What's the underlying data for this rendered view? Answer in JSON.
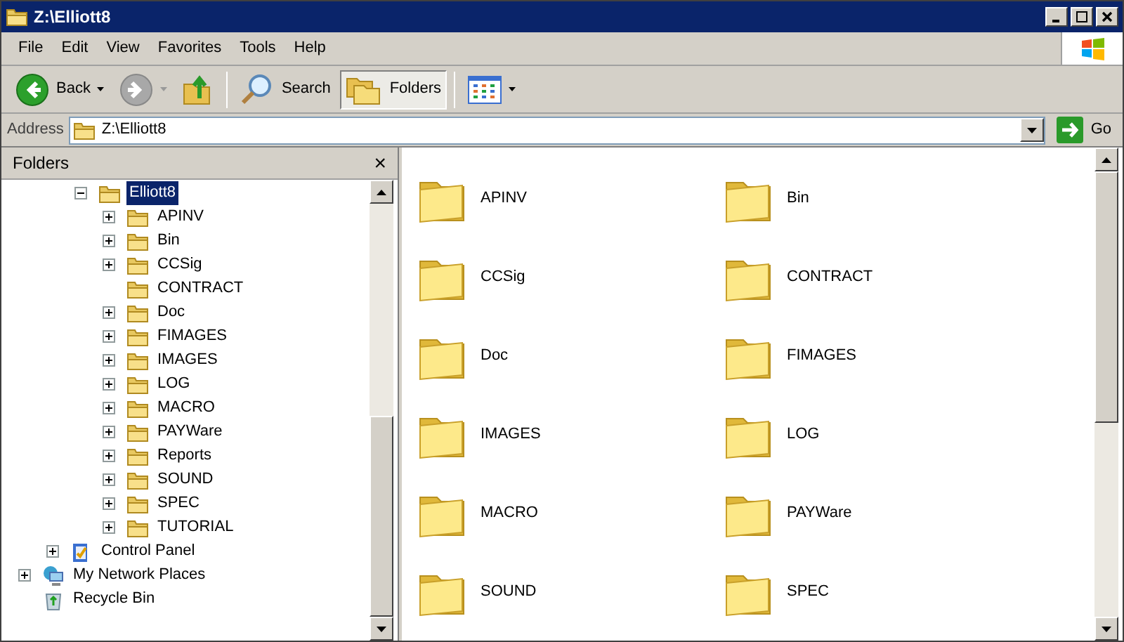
{
  "window": {
    "title": "Z:\\Elliott8"
  },
  "menu": [
    "File",
    "Edit",
    "View",
    "Favorites",
    "Tools",
    "Help"
  ],
  "toolbar": [
    {
      "kind": "back",
      "label": "Back",
      "disabled": false,
      "selected": false
    },
    {
      "kind": "forward",
      "disabled": true,
      "selected": false
    },
    {
      "kind": "up",
      "selected": false
    },
    {
      "kind": "search",
      "label": "Search",
      "selected": false
    },
    {
      "kind": "folders",
      "label": "Folders",
      "selected": true
    },
    {
      "kind": "views",
      "selected": false
    }
  ],
  "address": {
    "label": "Address",
    "value": "Z:\\Elliott8",
    "go": "Go"
  },
  "folders_pane": {
    "title": "Folders",
    "close": "×",
    "tree": [
      {
        "kind": "folder",
        "name": "Elliott8",
        "selected": true,
        "expandable": true,
        "expanded": true,
        "children": [
          {
            "kind": "folder",
            "name": "APINV",
            "selected": false,
            "expandable": true,
            "expanded": false
          },
          {
            "kind": "folder",
            "name": "Bin",
            "selected": false,
            "expandable": true,
            "expanded": false
          },
          {
            "kind": "folder",
            "name": "CCSig",
            "selected": false,
            "expandable": true,
            "expanded": false
          },
          {
            "kind": "folder",
            "name": "CONTRACT",
            "selected": false,
            "expandable": false
          },
          {
            "kind": "folder",
            "name": "Doc",
            "selected": false,
            "expandable": true,
            "expanded": false
          },
          {
            "kind": "folder",
            "name": "FIMAGES",
            "selected": false,
            "expandable": true,
            "expanded": false
          },
          {
            "kind": "folder",
            "name": "IMAGES",
            "selected": false,
            "expandable": true,
            "expanded": false
          },
          {
            "kind": "folder",
            "name": "LOG",
            "selected": false,
            "expandable": true,
            "expanded": false
          },
          {
            "kind": "folder",
            "name": "MACRO",
            "selected": false,
            "expandable": true,
            "expanded": false
          },
          {
            "kind": "folder",
            "name": "PAYWare",
            "selected": false,
            "expandable": true,
            "expanded": false
          },
          {
            "kind": "folder",
            "name": "Reports",
            "selected": false,
            "expandable": true,
            "expanded": false
          },
          {
            "kind": "folder",
            "name": "SOUND",
            "selected": false,
            "expandable": true,
            "expanded": false
          },
          {
            "kind": "folder",
            "name": "SPEC",
            "selected": false,
            "expandable": true,
            "expanded": false
          },
          {
            "kind": "folder",
            "name": "TUTORIAL",
            "selected": false,
            "expandable": true,
            "expanded": false
          }
        ]
      },
      {
        "kind": "control-panel",
        "name": "Control Panel",
        "selected": false,
        "expandable": true,
        "expanded": false
      },
      {
        "kind": "network",
        "name": "My Network Places",
        "selected": false,
        "expandable": true,
        "expanded": false
      },
      {
        "kind": "recycle-bin",
        "name": "Recycle Bin",
        "selected": false,
        "expandable": false
      }
    ]
  },
  "files": [
    {
      "name": "APINV"
    },
    {
      "name": "Bin"
    },
    {
      "name": "CCSig"
    },
    {
      "name": "CONTRACT"
    },
    {
      "name": "Doc"
    },
    {
      "name": "FIMAGES"
    },
    {
      "name": "IMAGES"
    },
    {
      "name": "LOG"
    },
    {
      "name": "MACRO"
    },
    {
      "name": "PAYWare"
    },
    {
      "name": "SOUND"
    },
    {
      "name": "SPEC"
    }
  ]
}
